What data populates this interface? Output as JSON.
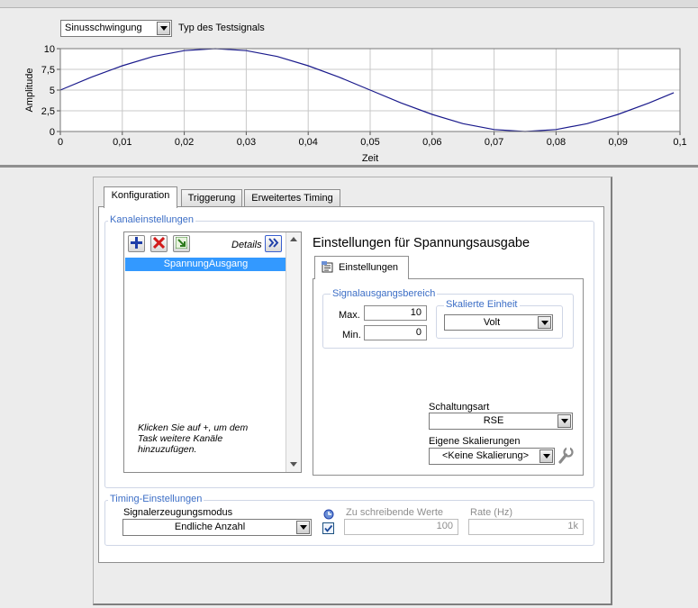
{
  "signal": {
    "type_value": "Sinusschwingung",
    "type_label": "Typ des Testsignals"
  },
  "chart_data": {
    "type": "line",
    "xlabel": "Zeit",
    "ylabel": "Amplitude",
    "xlim": [
      0,
      0.1
    ],
    "ylim": [
      0,
      10
    ],
    "x_ticks": [
      "0",
      "0,01",
      "0,02",
      "0,03",
      "0,04",
      "0,05",
      "0,06",
      "0,07",
      "0,08",
      "0,09",
      "0,1"
    ],
    "y_ticks": [
      "0",
      "2,5",
      "5",
      "7,5",
      "10"
    ],
    "grid": true,
    "series": [
      {
        "color": "#1a1a8c",
        "x": [
          0,
          0.005,
          0.01,
          0.015,
          0.02,
          0.025,
          0.03,
          0.035,
          0.04,
          0.045,
          0.05,
          0.055,
          0.06,
          0.065,
          0.07,
          0.075,
          0.08,
          0.085,
          0.09,
          0.095,
          0.099
        ],
        "y": [
          5,
          6.55,
          7.94,
          9.05,
          9.76,
          10,
          9.76,
          9.05,
          7.94,
          6.55,
          5,
          3.45,
          2.06,
          0.95,
          0.24,
          0,
          0.24,
          0.95,
          2.06,
          3.45,
          4.69
        ]
      }
    ]
  },
  "tabs": [
    {
      "label": "Konfiguration"
    },
    {
      "label": "Triggerung"
    },
    {
      "label": "Erweitertes Timing"
    }
  ],
  "channels": {
    "group_title": "Kanaleinstellungen",
    "details_label": "Details",
    "items": [
      "SpannungAusgang"
    ],
    "hint": "Klicken Sie auf +, um dem Task weitere Kanäle hinzuzufügen."
  },
  "output": {
    "title": "Einstellungen für Spannungsausgabe",
    "subtab_label": "Einstellungen",
    "range_title": "Signalausgangsbereich",
    "max_label": "Max.",
    "max_value": "10",
    "min_label": "Min.",
    "min_value": "0",
    "unit_title": "Skalierte Einheit",
    "unit_value": "Volt",
    "wiring_label": "Schaltungsart",
    "wiring_value": "RSE",
    "scaling_label": "Eigene Skalierungen",
    "scaling_value": "<Keine Skalierung>"
  },
  "timing": {
    "group_title": "Timing-Einstellungen",
    "mode_label": "Signalerzeugungsmodus",
    "mode_value": "Endliche Anzahl",
    "samples_label": "Zu schreibende Werte",
    "samples_value": "100",
    "rate_label": "Rate (Hz)",
    "rate_value": "1k"
  },
  "colors": {
    "accent": "#3c6ec6",
    "selection": "#3399ff",
    "plot_line": "#1a1a8c"
  }
}
